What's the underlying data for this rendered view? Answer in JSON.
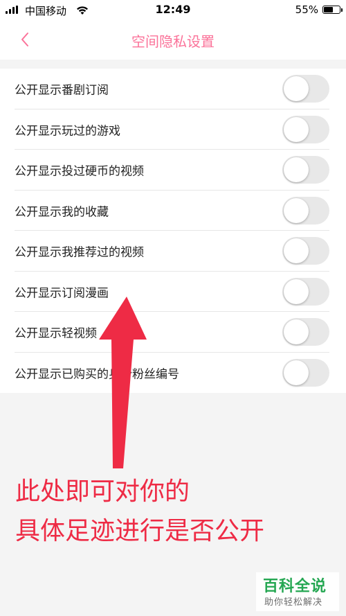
{
  "status_bar": {
    "carrier": "中国移动",
    "time": "12:49",
    "battery_percent": "55%",
    "battery_level": 0.55
  },
  "nav": {
    "title": "空间隐私设置",
    "back_icon": "chevron-left-icon"
  },
  "settings": [
    {
      "label": "公开显示番剧订阅",
      "enabled": false
    },
    {
      "label": "公开显示玩过的游戏",
      "enabled": false
    },
    {
      "label": "公开显示投过硬币的视频",
      "enabled": false
    },
    {
      "label": "公开显示我的收藏",
      "enabled": false
    },
    {
      "label": "公开显示我推荐过的视频",
      "enabled": false
    },
    {
      "label": "公开显示订阅漫画",
      "enabled": false
    },
    {
      "label": "公开显示轻视频",
      "enabled": false
    },
    {
      "label": "公开显示已购买的身份粉丝编号",
      "enabled": false
    }
  ],
  "annotation": {
    "line1": "此处即可对你的",
    "line2": "具体足迹进行是否公开"
  },
  "watermark": {
    "title": "百科全说",
    "subtitle": "助你轻松解决"
  },
  "colors": {
    "accent": "#fb7299",
    "annotation": "#ee2b45",
    "watermark": "#1aa34a"
  }
}
